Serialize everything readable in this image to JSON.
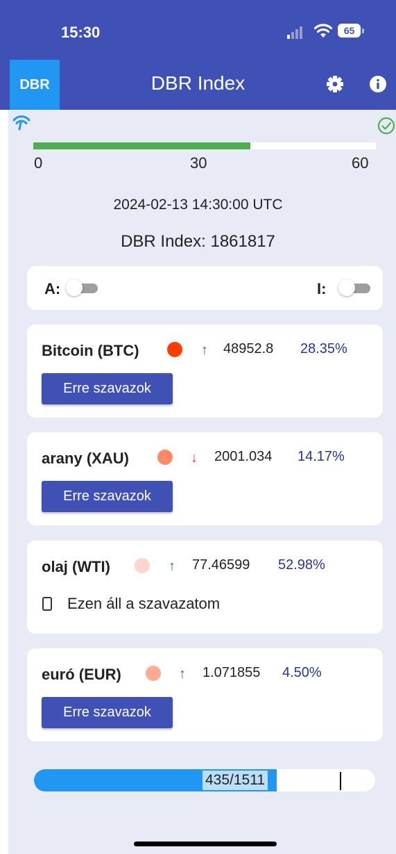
{
  "status": {
    "time": "15:30",
    "battery": "65"
  },
  "app": {
    "logo": "DBR",
    "title": "DBR Index"
  },
  "timer": {
    "value": 38,
    "min": 0,
    "max": 60,
    "ticks": [
      "0",
      "30",
      "60"
    ]
  },
  "timestamp": "2024-02-13 14:30:00 UTC",
  "index": {
    "label": "DBR Index: 1861817"
  },
  "toggles": {
    "a_label": "A:",
    "i_label": "I:"
  },
  "assets": [
    {
      "name": "Bitcoin (BTC)",
      "dot_color": "#ff3d00",
      "direction": "up",
      "arrow": "↑",
      "price": "48952.8",
      "percent": "28.35%",
      "button": "Erre szavazok"
    },
    {
      "name": "arany (XAU)",
      "dot_color": "#ff8a65",
      "direction": "down",
      "arrow": "↓",
      "price": "2001.034",
      "percent": "14.17%",
      "button": "Erre szavazok"
    },
    {
      "name": "olaj (WTI)",
      "dot_color": "#ffd5cc",
      "direction": "up",
      "arrow": "↑",
      "price": "77.46599",
      "percent": "52.98%",
      "my_vote": "Ezen áll a szavazatom"
    },
    {
      "name": "euró (EUR)",
      "dot_color": "#ffab91",
      "direction": "up",
      "arrow": "↑",
      "price": "1.071855",
      "percent": "4.50%",
      "button": "Erre szavazok"
    }
  ],
  "counter": {
    "text": "435/1511",
    "fill_fraction": 0.712
  },
  "colors": {
    "primary": "#3f51b5",
    "accent": "#2196f3",
    "success": "#4caf50",
    "background": "#e8eaf6"
  }
}
